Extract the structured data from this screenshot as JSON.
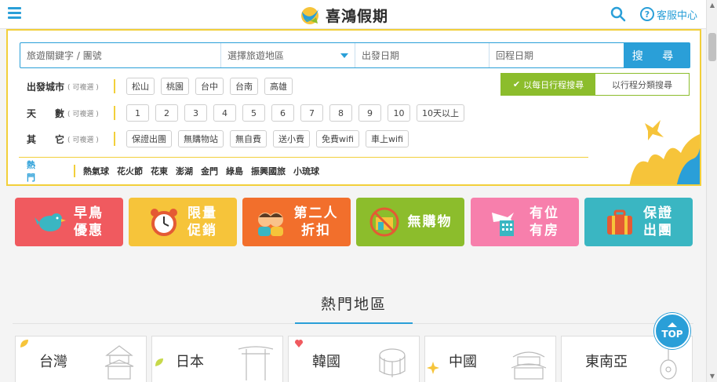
{
  "header": {
    "brand": "喜鴻假期",
    "customer_service": "客服中心"
  },
  "search": {
    "keyword_placeholder": "旅遊關鍵字 / 團號",
    "region_select": "選擇旅遊地區",
    "depart_placeholder": "出發日期",
    "return_placeholder": "回程日期",
    "search_button": "搜 尋"
  },
  "filters": {
    "city": {
      "label": "出發城市",
      "sub": "( 可複選 )",
      "options": [
        "松山",
        "桃園",
        "台中",
        "台南",
        "高雄"
      ]
    },
    "days": {
      "label": "天　　數",
      "sub": "( 可複選 )",
      "options": [
        "1",
        "2",
        "3",
        "4",
        "5",
        "6",
        "7",
        "8",
        "9",
        "10",
        "10天以上"
      ]
    },
    "other": {
      "label": "其　　它",
      "sub": "( 可複選 )",
      "options": [
        "保證出團",
        "無購物站",
        "無自費",
        "送小費",
        "免費wifi",
        "車上wifi"
      ]
    }
  },
  "toggle": {
    "daily": "以每日行程搜尋",
    "category": "以行程分類搜尋"
  },
  "hot_links": {
    "label": "熱門",
    "items": [
      "熱氣球",
      "花火節",
      "花東",
      "澎湖",
      "金門",
      "綠島",
      "振興國旅",
      "小琉球"
    ]
  },
  "categories": [
    {
      "line1": "早鳥",
      "line2": "優惠",
      "color": "#f05a5f",
      "icon": "bird-icon"
    },
    {
      "line1": "限量",
      "line2": "促銷",
      "color": "#f6c43a",
      "icon": "alarm-clock-icon"
    },
    {
      "line1": "第二人",
      "line2": "折扣",
      "color": "#f26f2c",
      "icon": "two-people-icon"
    },
    {
      "line1": "無購物",
      "line2": "",
      "color": "#8cbd2c",
      "icon": "no-shopping-icon"
    },
    {
      "line1": "有位",
      "line2": "有房",
      "color": "#f77fac",
      "icon": "hotel-plane-icon"
    },
    {
      "line1": "保證",
      "line2": "出團",
      "color": "#3ab6c2",
      "icon": "suitcase-icon"
    }
  ],
  "hot_region": {
    "title": "熱門地區",
    "items": [
      "台灣",
      "日本",
      "韓國",
      "中國",
      "東南亞"
    ]
  },
  "top_button": "TOP"
}
